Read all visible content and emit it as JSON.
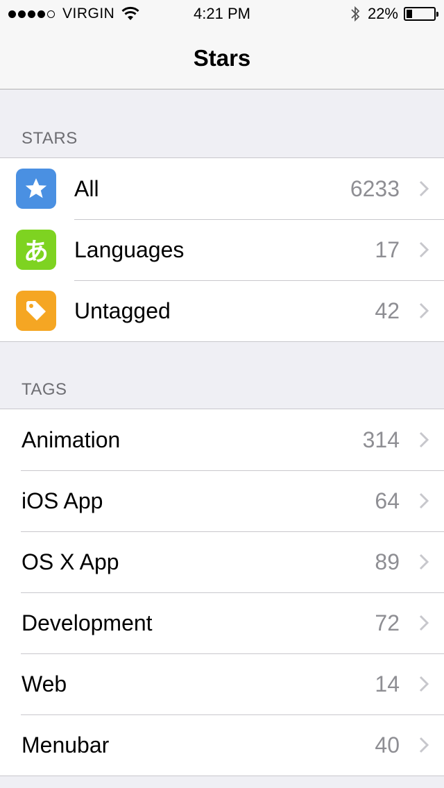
{
  "status_bar": {
    "carrier": "VIRGIN",
    "time": "4:21 PM",
    "battery_percent": "22%",
    "battery_level": 0.22
  },
  "nav": {
    "title": "Stars"
  },
  "stars_section": {
    "header": "STARS",
    "items": [
      {
        "label": "All",
        "count": "6233",
        "icon": "star-icon",
        "icon_color": "#4a90e2"
      },
      {
        "label": "Languages",
        "count": "17",
        "icon": "hiragana-a-icon",
        "icon_glyph": "あ",
        "icon_color": "#7ed321"
      },
      {
        "label": "Untagged",
        "count": "42",
        "icon": "tag-icon",
        "icon_color": "#f5a623"
      }
    ]
  },
  "tags_section": {
    "header": "TAGS",
    "items": [
      {
        "label": "Animation",
        "count": "314"
      },
      {
        "label": "iOS App",
        "count": "64"
      },
      {
        "label": "OS X App",
        "count": "89"
      },
      {
        "label": "Development",
        "count": "72"
      },
      {
        "label": "Web",
        "count": "14"
      },
      {
        "label": "Menubar",
        "count": "40"
      }
    ]
  }
}
